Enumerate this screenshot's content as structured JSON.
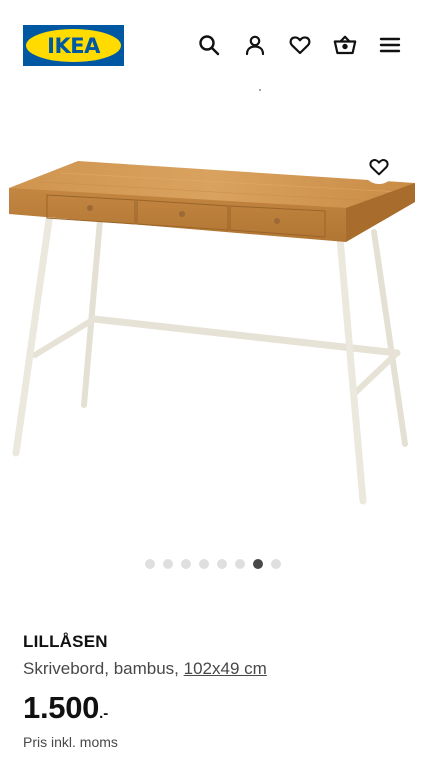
{
  "header": {
    "logo_text": "IKEA",
    "icons": [
      "search-icon",
      "account-icon",
      "heart-icon",
      "basket-icon",
      "menu-icon"
    ]
  },
  "gallery": {
    "image": "Desk with bamboo top, three drawers and white metal legs",
    "favorite_icon": "heart-icon",
    "total_images": 8,
    "active_index": 6
  },
  "product": {
    "name": "LILLÅSEN",
    "description": "Skrivebord, bambus, ",
    "dimensions": "102x49 cm",
    "price": "1.500",
    "price_suffix": ".-",
    "vat_note": "Pris inkl. moms"
  },
  "colors": {
    "brand_blue": "#0058a3",
    "brand_yellow": "#ffdb00",
    "text": "#111111",
    "muted": "#484848"
  }
}
